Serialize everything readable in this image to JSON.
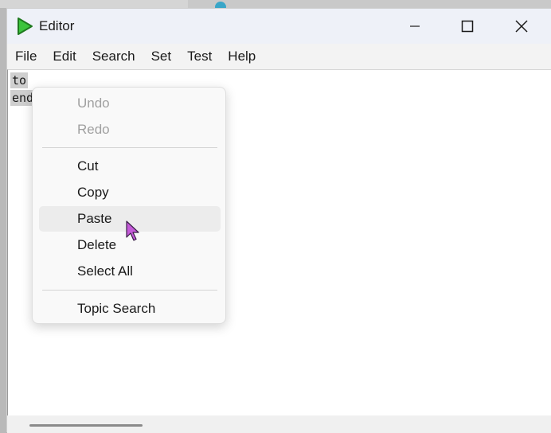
{
  "window": {
    "title": "Editor",
    "controls": {
      "minimize": "minimize",
      "maximize": "maximize",
      "close": "close"
    }
  },
  "menubar": {
    "items": [
      "File",
      "Edit",
      "Search",
      "Set",
      "Test",
      "Help"
    ]
  },
  "editor": {
    "lines": [
      "to",
      "end"
    ]
  },
  "context_menu": {
    "items": [
      {
        "label": "Undo",
        "enabled": false
      },
      {
        "label": "Redo",
        "enabled": false
      },
      {
        "label": "Cut",
        "enabled": true
      },
      {
        "label": "Copy",
        "enabled": true
      },
      {
        "label": "Paste",
        "enabled": true,
        "hovered": true
      },
      {
        "label": "Delete",
        "enabled": true
      },
      {
        "label": "Select All",
        "enabled": true
      },
      {
        "label": "Topic Search",
        "enabled": true
      }
    ]
  },
  "colors": {
    "accent_icon": "#3cc43c",
    "cursor": "#c45ad8",
    "disabled_text": "#a0a0a0"
  }
}
